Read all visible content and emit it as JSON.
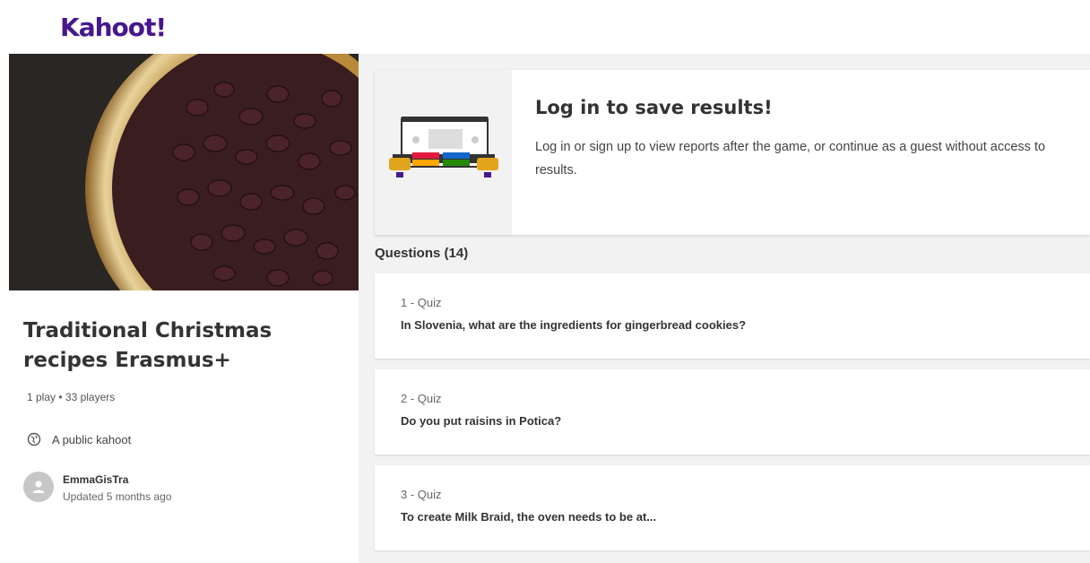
{
  "header": {
    "logo_text": "Kahoot",
    "logo_bang": "!"
  },
  "kahoot": {
    "title": "Traditional Christmas recipes Erasmus+",
    "meta": "1 play • 33 players",
    "visibility": "A public kahoot",
    "author": "EmmaGisTra",
    "updated": "Updated 5 months ago"
  },
  "login_card": {
    "title": "Log in to save results!",
    "description": "Log in or sign up to view reports after the game, or continue as a guest without access to results."
  },
  "questions": {
    "label": "Questions (14)",
    "items": [
      {
        "type": "1 - Quiz",
        "text": "In Slovenia, what are the ingredients for gingerbread cookies?"
      },
      {
        "type": "2 - Quiz",
        "text": "Do you put raisins in Potica?"
      },
      {
        "type": "3 - Quiz",
        "text": "To create Milk Braid, the oven needs to be at..."
      }
    ]
  },
  "colors": {
    "brand": "#46178f",
    "panel": "#f2f2f2"
  }
}
